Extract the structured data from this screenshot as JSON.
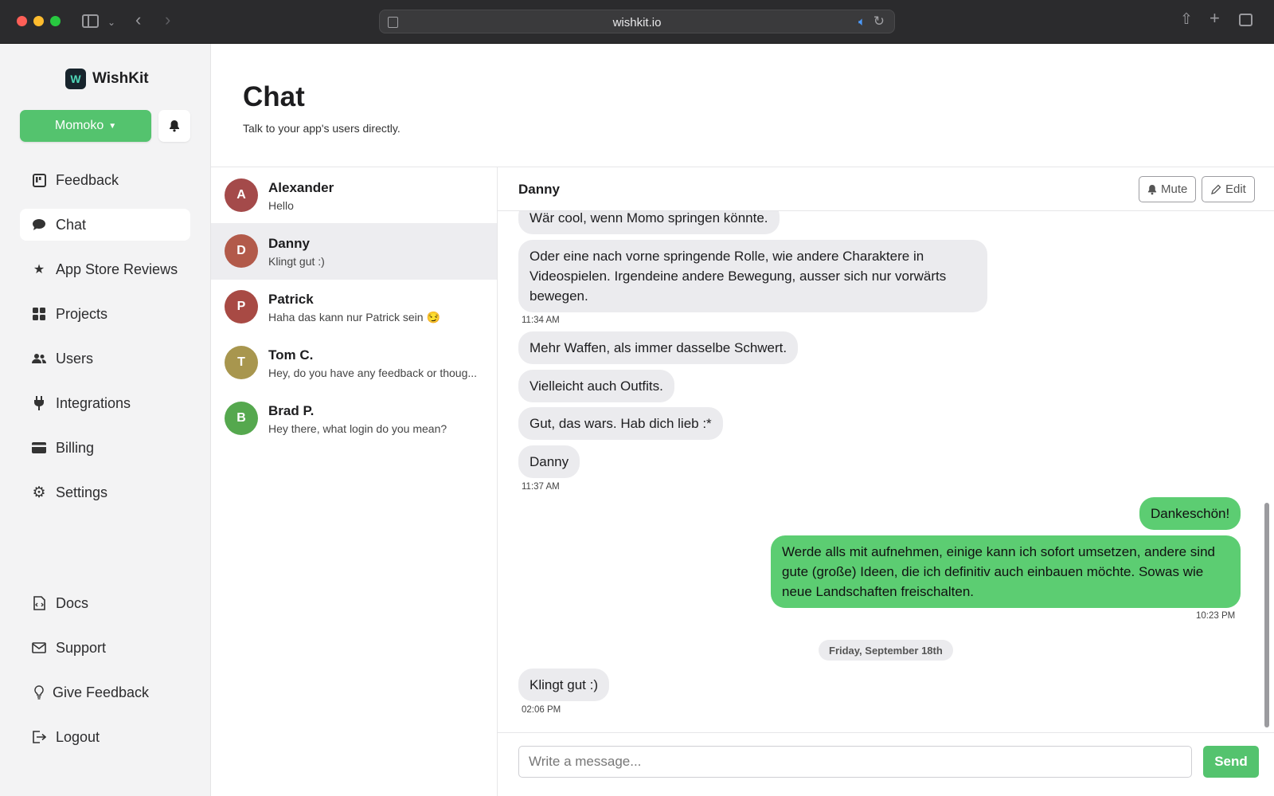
{
  "browser": {
    "url": "wishkit.io"
  },
  "app": {
    "name": "WishKit",
    "user_button": "Momoko"
  },
  "sidebar": {
    "items": [
      {
        "label": "Feedback",
        "icon": "feedback-board-icon"
      },
      {
        "label": "Chat",
        "icon": "chat-bubble-icon",
        "active": true
      },
      {
        "label": "App Store Reviews",
        "icon": "star-icon"
      },
      {
        "label": "Projects",
        "icon": "grid-icon"
      },
      {
        "label": "Users",
        "icon": "users-icon"
      },
      {
        "label": "Integrations",
        "icon": "plug-icon"
      },
      {
        "label": "Billing",
        "icon": "credit-card-icon"
      },
      {
        "label": "Settings",
        "icon": "gear-icon"
      }
    ],
    "bottom_items": [
      {
        "label": "Docs",
        "icon": "docs-icon"
      },
      {
        "label": "Support",
        "icon": "envelope-icon"
      },
      {
        "label": "Give Feedback",
        "icon": "lightbulb-icon"
      },
      {
        "label": "Logout",
        "icon": "logout-icon"
      }
    ]
  },
  "page": {
    "title": "Chat",
    "subtitle": "Talk to your app's users directly."
  },
  "conversations": [
    {
      "initial": "A",
      "name": "Alexander",
      "preview": "Hello",
      "color": "#a44a4a"
    },
    {
      "initial": "D",
      "name": "Danny",
      "preview": "Klingt gut :)",
      "color": "#b25a4a",
      "active": true
    },
    {
      "initial": "P",
      "name": "Patrick",
      "preview": "Haha das kann nur Patrick sein 😏",
      "color": "#a84a44"
    },
    {
      "initial": "T",
      "name": "Tom C.",
      "preview": "Hey, do you have any feedback or thoug...",
      "color": "#a8964e"
    },
    {
      "initial": "B",
      "name": "Brad P.",
      "preview": "Hey there, what login do you mean?",
      "color": "#55a84e"
    }
  ],
  "chat": {
    "contact": "Danny",
    "mute_label": "Mute",
    "edit_label": "Edit",
    "messages": [
      {
        "text": "Wär cool, wenn Momo springen könnte.",
        "dir": "in"
      },
      {
        "text": "Oder eine nach vorne springende Rolle, wie andere Charaktere in Videospielen. Irgendeine andere Bewegung, ausser sich nur vorwärts bewegen.",
        "dir": "in"
      },
      {
        "time": "11:34 AM"
      },
      {
        "text": "Mehr Waffen, als immer dasselbe Schwert.",
        "dir": "in"
      },
      {
        "text": "Vielleicht auch Outfits.",
        "dir": "in"
      },
      {
        "text": "Gut, das wars. Hab dich lieb :*",
        "dir": "in"
      },
      {
        "text": "Danny",
        "dir": "in"
      },
      {
        "time": "11:37 AM"
      },
      {
        "text": "Dankeschön!",
        "dir": "out"
      },
      {
        "text": "Werde alls mit aufnehmen, einige kann ich sofort umsetzen, andere sind gute (große) Ideen, die ich definitiv auch einbauen möchte. Sowas wie neue Landschaften freischalten.",
        "dir": "out"
      },
      {
        "time": "10:23 PM"
      },
      {
        "date": "Friday, September 18th"
      },
      {
        "text": "Klingt gut :)",
        "dir": "in"
      },
      {
        "time": "02:06 PM"
      }
    ],
    "composer_placeholder": "Write a message...",
    "send_label": "Send"
  }
}
